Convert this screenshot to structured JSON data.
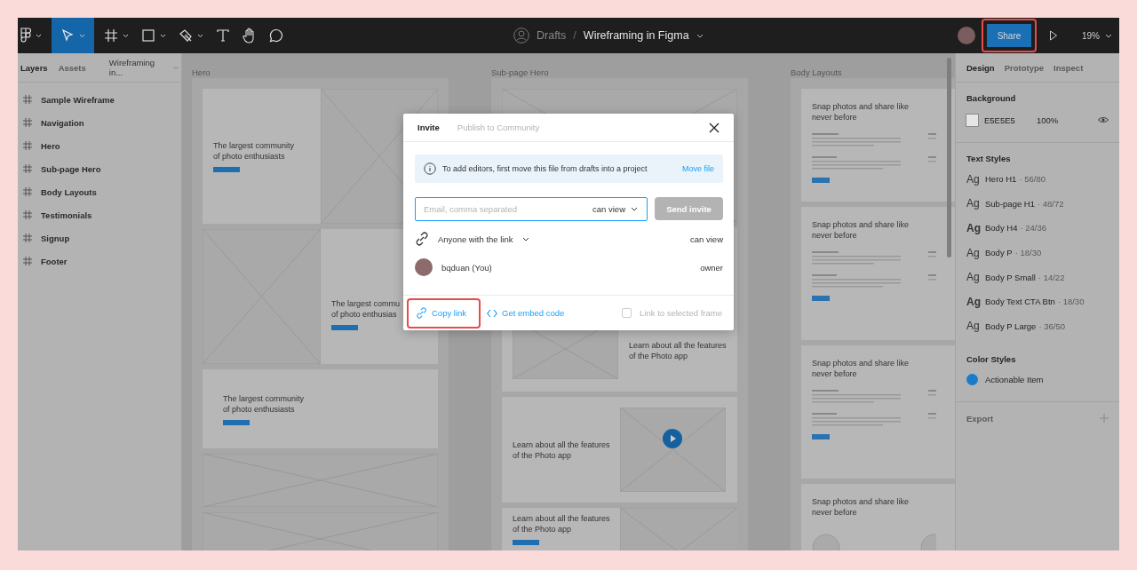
{
  "toolbar": {
    "tools": [
      {
        "kind": "logo",
        "selected": false,
        "menu": true
      },
      {
        "kind": "move",
        "selected": true,
        "menu": true
      },
      {
        "kind": "frame",
        "selected": false,
        "menu": true
      },
      {
        "kind": "shape",
        "selected": false,
        "menu": true
      },
      {
        "kind": "pen",
        "selected": false,
        "menu": true
      },
      {
        "kind": "text",
        "selected": false,
        "menu": false
      },
      {
        "kind": "hand",
        "selected": false,
        "menu": false
      },
      {
        "kind": "comment",
        "selected": false,
        "menu": false
      }
    ],
    "folder": "Drafts",
    "separator": "/",
    "file": "Wireframing in Figma",
    "share": {
      "label": "Share",
      "highlighted": true
    },
    "zoom": "19%"
  },
  "layers_panel": {
    "tabs": [
      {
        "label": "Layers",
        "selected": true
      },
      {
        "label": "Assets",
        "selected": false
      }
    ],
    "page": "Wireframing in...",
    "layers": [
      "Sample Wireframe",
      "Navigation",
      "Hero",
      "Sub-page Hero",
      "Body Layouts",
      "Testimonials",
      "Signup",
      "Footer"
    ]
  },
  "canvas": {
    "frames": [
      {
        "title": "Hero",
        "cards": [
          {
            "kind": "text-image",
            "lines": [
              "The largest community",
              "of photo enthusiasts"
            ]
          },
          {
            "kind": "image-text",
            "lines": [
              "The largest commu",
              "of photo enthusias"
            ]
          },
          {
            "kind": "text-band",
            "lines": [
              "The largest community",
              "of photo enthusiasts"
            ]
          },
          {
            "kind": "image"
          },
          {
            "kind": "image"
          }
        ]
      },
      {
        "title": "Sub-page Hero",
        "cards": [
          {
            "kind": "image"
          },
          {
            "kind": "image-caption",
            "lines": [
              "Learn about all the features",
              "of the Photo app"
            ]
          },
          {
            "kind": "text-video",
            "lines": [
              "Learn about all the features",
              "of the Photo app"
            ]
          },
          {
            "kind": "text-image",
            "lines": [
              "Learn about all the features",
              "of the Photo app"
            ]
          }
        ]
      },
      {
        "title": "Body Layouts",
        "cards": [
          {
            "kind": "text-list",
            "lines": [
              "Snap photos and share like",
              "never before"
            ]
          },
          {
            "kind": "text-list",
            "lines": [
              "Snap photos and share like",
              "never before"
            ]
          },
          {
            "kind": "text-list",
            "lines": [
              "Snap photos and share like",
              "never before"
            ]
          },
          {
            "kind": "text-avatars",
            "lines": [
              "Snap photos and share like",
              "never before"
            ]
          }
        ]
      }
    ]
  },
  "share_dialog": {
    "tabs": [
      {
        "label": "Invite",
        "selected": true
      },
      {
        "label": "Publish to Community",
        "selected": false
      }
    ],
    "notice": {
      "text": "To add editors, first move this file from drafts into a project",
      "link": "Move file"
    },
    "invite": {
      "placeholder": "Email, comma separated",
      "permission": "can view",
      "button": "Send invite",
      "disabled": true
    },
    "link_access": {
      "label": "Anyone with the link",
      "permission": "can view"
    },
    "members": [
      {
        "name": "bqduan (You)",
        "role": "owner"
      }
    ],
    "copy_link": {
      "label": "Copy link",
      "highlighted": true
    },
    "embed": "Get embed code",
    "frame_option": {
      "label": "Link to selected frame",
      "checked": false,
      "disabled": true
    }
  },
  "design_panel": {
    "tabs": [
      {
        "label": "Design",
        "selected": true
      },
      {
        "label": "Prototype",
        "selected": false
      },
      {
        "label": "Inspect",
        "selected": false
      }
    ],
    "background": {
      "title": "Background",
      "hex": "E5E5E5",
      "opacity": "100%",
      "color": "#e5e5e5"
    },
    "text_styles": {
      "title": "Text Styles",
      "items": [
        {
          "sample": "Ag",
          "bold": false,
          "name": "Hero H1",
          "spec": "· 56/80"
        },
        {
          "sample": "Ag",
          "bold": false,
          "name": "Sub-page H1",
          "spec": "· 48/72"
        },
        {
          "sample": "Ag",
          "bold": true,
          "name": "Body H4",
          "spec": "· 24/36"
        },
        {
          "sample": "Ag",
          "bold": false,
          "name": "Body P",
          "spec": "· 18/30"
        },
        {
          "sample": "Ag",
          "bold": false,
          "name": "Body P Small",
          "spec": "· 14/22"
        },
        {
          "sample": "Ag",
          "bold": true,
          "name": "Body Text CTA Btn",
          "spec": "· 18/30"
        },
        {
          "sample": "Ag",
          "bold": false,
          "name": "Body P Large",
          "spec": "· 36/50"
        }
      ]
    },
    "color_styles": {
      "title": "Color Styles",
      "items": [
        {
          "name": "Actionable Item",
          "color": "#1a7cc9"
        }
      ]
    },
    "export": "Export"
  }
}
